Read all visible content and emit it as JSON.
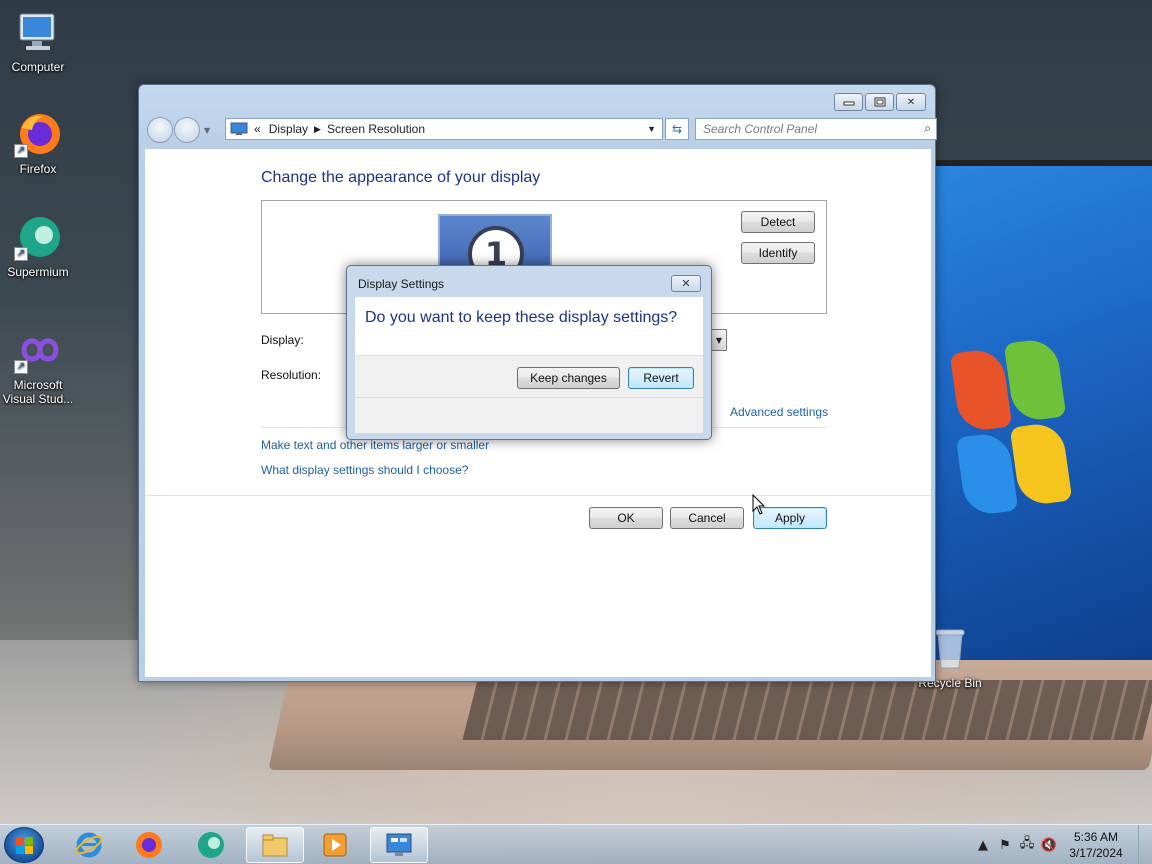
{
  "desktop": {
    "icons": [
      {
        "label": "Computer"
      },
      {
        "label": "Firefox"
      },
      {
        "label": "Supermium"
      },
      {
        "label": "Microsoft Visual Stud..."
      },
      {
        "label": "Recycle Bin"
      }
    ]
  },
  "window": {
    "caption_buttons": {
      "minimize": "▭",
      "maximize": "▭",
      "close": "✕"
    },
    "address": {
      "overflow": "«",
      "crumbs": [
        "Display",
        "Screen Resolution"
      ]
    },
    "search": {
      "placeholder": "Search Control Panel"
    },
    "heading": "Change the appearance of your display",
    "monitor_number": "1",
    "buttons": {
      "detect": "Detect",
      "identify": "Identify",
      "ok": "OK",
      "cancel": "Cancel",
      "apply": "Apply"
    },
    "labels": {
      "display": "Display:",
      "resolution": "Resolution:"
    },
    "links": {
      "advanced": "Advanced settings",
      "text_size": "Make text and other items larger or smaller",
      "help": "What display settings should I choose?"
    }
  },
  "dialog": {
    "title": "Display Settings",
    "question": "Do you want to keep these display settings?",
    "keep_label": "Keep changes",
    "revert_label": "Revert"
  },
  "taskbar": {
    "clock_time": "5:36 AM",
    "clock_date": "3/17/2024",
    "pinned": [
      "start-button",
      "internet-explorer-icon",
      "firefox-icon",
      "supermium-icon",
      "file-explorer-icon",
      "media-player-icon",
      "control-panel-icon"
    ]
  },
  "colors": {
    "heading": "#1e3287",
    "link": "#1e5fa6",
    "window_frame": "#b8cfe6"
  }
}
